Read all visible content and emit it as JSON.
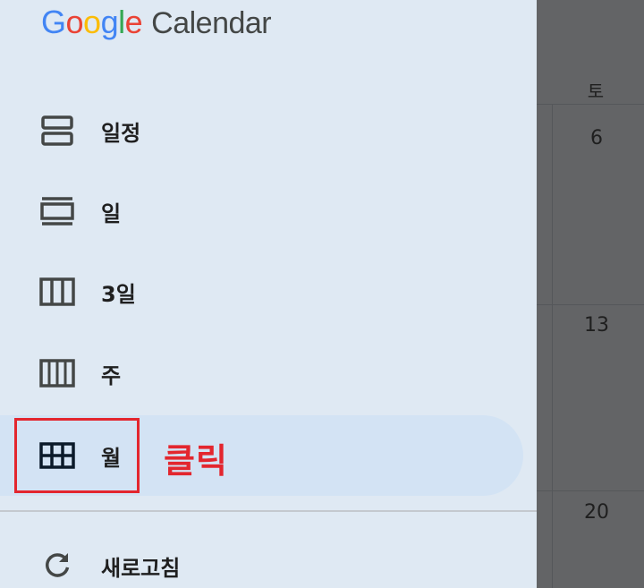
{
  "app": {
    "logo_letters": [
      "G",
      "o",
      "o",
      "g",
      "l",
      "e"
    ],
    "product_name": "Calendar"
  },
  "view_menu": {
    "items": [
      {
        "label": "일정",
        "icon": "schedule-view-icon"
      },
      {
        "label": "일",
        "icon": "day-view-icon"
      },
      {
        "label": "3일",
        "icon": "three-day-view-icon"
      },
      {
        "label": "주",
        "icon": "week-view-icon"
      },
      {
        "label": "월",
        "icon": "month-view-icon",
        "selected": true
      }
    ],
    "refresh_label": "새로고침",
    "refresh_icon": "refresh-icon"
  },
  "annotation": {
    "text": "클릭",
    "color": "#e3262e"
  },
  "calendar_background": {
    "day_header": "토",
    "dates": [
      "6",
      "13",
      "20"
    ]
  },
  "colors": {
    "drawer_background": "#dfe9f3",
    "selected_item_background": "#d3e3f4",
    "scrim": "#636466"
  }
}
